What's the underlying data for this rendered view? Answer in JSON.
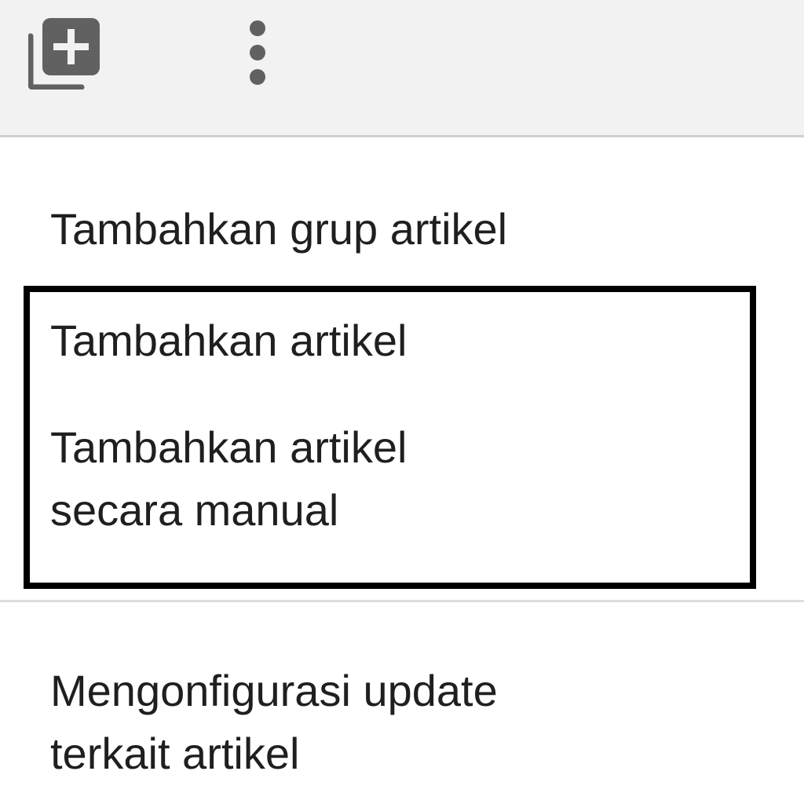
{
  "toolbar": {
    "add_icon": "library-add-icon",
    "more_icon": "more-vert-icon",
    "icon_color": "#616161",
    "background": "#f2f2f2"
  },
  "menu": {
    "items": [
      {
        "lines": [
          "Tambahkan grup artikel"
        ]
      },
      {
        "lines": [
          "Tambahkan artikel"
        ]
      },
      {
        "lines": [
          "Tambahkan artikel",
          "secara manual"
        ]
      },
      {
        "lines": [
          "Mengonfigurasi update",
          "terkait artikel"
        ]
      }
    ],
    "highlight_color": "#000000",
    "text_color": "#1f1f1f"
  }
}
